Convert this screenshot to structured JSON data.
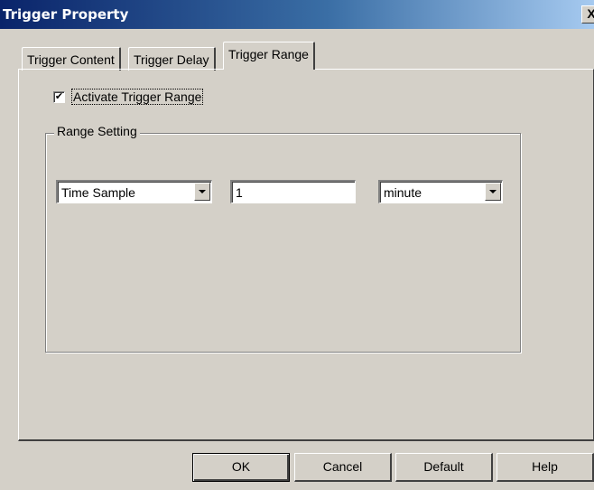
{
  "window": {
    "title": "Trigger Property",
    "close_glyph": "X"
  },
  "tabs": [
    {
      "label": "Trigger Content"
    },
    {
      "label": "Trigger Delay"
    },
    {
      "label": "Trigger Range",
      "active": true
    }
  ],
  "activate": {
    "label": "Activate Trigger Range",
    "checked": true,
    "check_glyph": "✔"
  },
  "range_setting": {
    "group_label": "Range Setting",
    "mode_select": {
      "value": "Time Sample"
    },
    "amount_input": {
      "value": "1"
    },
    "unit_select": {
      "value": "minute"
    }
  },
  "buttons": {
    "ok": "OK",
    "cancel": "Cancel",
    "default": "Default",
    "help": "Help"
  },
  "colors": {
    "title_bar_start": "#0a246a",
    "title_bar_end": "#a6caf0",
    "face": "#d4d0c8"
  }
}
